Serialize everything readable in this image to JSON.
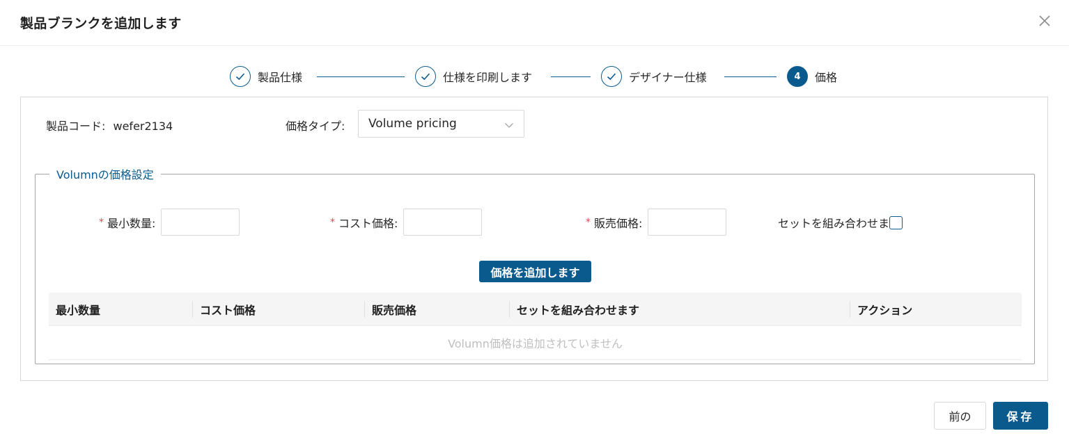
{
  "modal": {
    "title": "製品ブランクを追加します"
  },
  "steps": [
    {
      "label": "製品仕様",
      "status": "done"
    },
    {
      "label": "仕様を印刷します",
      "status": "done"
    },
    {
      "label": "デザイナー仕様",
      "status": "done"
    },
    {
      "label": "価格",
      "status": "active",
      "number": "4"
    }
  ],
  "product": {
    "code_label": "製品コード:",
    "code_value": "wefer2134",
    "price_type_label": "価格タイプ:",
    "price_type_value": "Volume pricing"
  },
  "volumn": {
    "legend": "Volumnの価格設定",
    "min_qty_label": "最小数量:",
    "cost_label": "コスト価格:",
    "sale_label": "販売価格:",
    "set_label": "セットを組み合わせま",
    "add_button": "価格を追加します",
    "table": {
      "columns": [
        "最小数量",
        "コスト価格",
        "販売価格",
        "セットを組み合わせます",
        "アクション"
      ],
      "empty_text": "Volumn価格は追加されていません"
    }
  },
  "footer": {
    "prev_label": "前の",
    "save_label": "保存"
  },
  "colors": {
    "primary": "#0b5a8e",
    "required": "#e5484d"
  }
}
